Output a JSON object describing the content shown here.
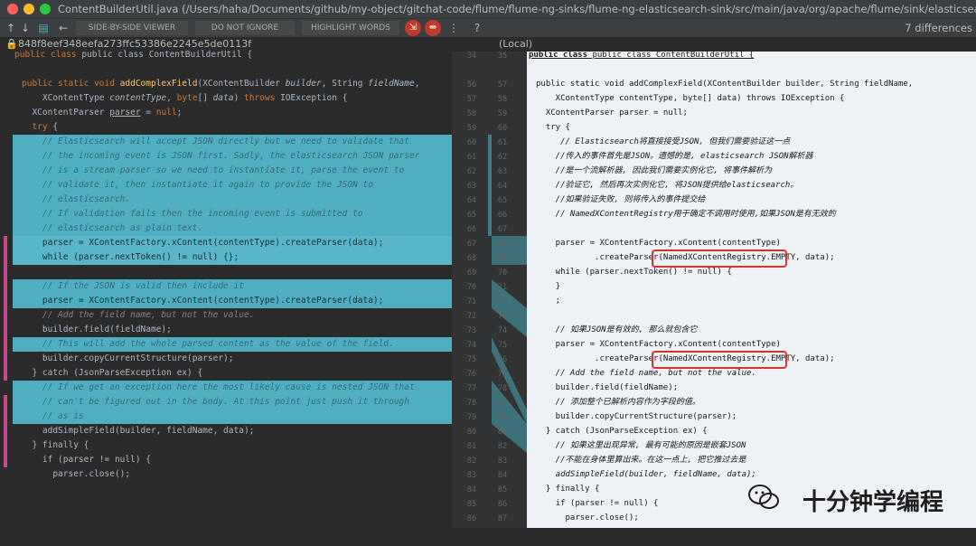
{
  "window": {
    "title": "ContentBuilderUtil.java (/Users/haha/Documents/github/my-object/gitchat-code/flume/flume-ng-sinks/flume-ng-elasticsearch-sink/src/main/java/org/apache/flume/sink/elasticsearch)",
    "differences": "7 differences"
  },
  "toolbar": {
    "viewer_label": "SIDE-BY-SIDE VIEWER",
    "ignore_label": "DO NOT IGNORE",
    "highlight_label": "HIGHLIGHT WORDS",
    "icons": [
      "arrow-up-icon",
      "arrow-down-icon",
      "edit-source-icon",
      "arrow-left-icon",
      "settings-icon",
      "help-icon"
    ]
  },
  "left": {
    "revision": "848f8eef348eefa273ffc53386e2245e5de0113f",
    "sticky": "public class ContentBuilderUtil {"
  },
  "right": {
    "revision": "(Local)",
    "sticky": "public class ContentBuilderUtil {"
  },
  "gutter_left": [
    "34",
    "56",
    "57",
    "58",
    "59",
    "60",
    "61",
    "62",
    "63",
    "64",
    "65",
    "66",
    "67",
    "68",
    "69",
    "70",
    "71",
    "72",
    "73",
    "74",
    "75",
    "76",
    "77",
    "78",
    "79",
    "80",
    "81",
    "82",
    "83",
    "84",
    "85",
    "86",
    "87"
  ],
  "gutter_right": [
    "35",
    "57",
    "58",
    "59",
    "60",
    "61",
    "62",
    "63",
    "64",
    "65",
    "66",
    "67",
    "68",
    "69",
    "70",
    "71",
    "72",
    "73",
    "74",
    "75",
    "76",
    "77",
    "78",
    "79",
    "80",
    "81",
    "82",
    "83",
    "84",
    "85",
    "86",
    "87"
  ],
  "left_code": [
    "public static void addComplexField(XContentBuilder builder, String fieldName,",
    "    XContentType contentType, byte[] data) throws IOException {",
    "  XContentParser parser = null;",
    "  try {",
    "    // Elasticsearch will accept JSON directly but we need to validate that",
    "    // the incoming event is JSON first. Sadly, the elasticsearch JSON parser",
    "    // is a stream parser so we need to instantiate it, parse the event to",
    "    // validate it, then instantiate it again to provide the JSON to",
    "    // elasticsearch.",
    "    // If validation fails then the incoming event is submitted to",
    "    // elasticsearch as plain text.",
    "    parser = XContentFactory.xContent(contentType).createParser(data);",
    "    while (parser.nextToken() != null) {};",
    "",
    "    // If the JSON is valid then include it",
    "    parser = XContentFactory.xContent(contentType).createParser(data);",
    "    // Add the field name, but not the value.",
    "    builder.field(fieldName);",
    "    // This will add the whole parsed content as the value of the field.",
    "    builder.copyCurrentStructure(parser);",
    "  } catch (JsonParseException ex) {",
    "    // If we get an exception here the most likely cause is nested JSON that",
    "    // can't be figured out in the body. At this point just push it through",
    "    // as is",
    "    addSimpleField(builder, fieldName, data);",
    "  } finally {",
    "    if (parser != null) {",
    "      parser.close();"
  ],
  "right_code": [
    "public static void addComplexField(XContentBuilder builder, String fieldName,",
    "    XContentType contentType, byte[] data) throws IOException {",
    "  XContentParser parser = null;",
    "  try {",
    "     // Elasticsearch将直接接受JSON, 但我们需要验证这一点",
    "    //传入的事件首先是JSON。遗憾的是, elasticsearch JSON解析器",
    "    //是一个流解析器, 因此我们需要实例化它, 将事件解析为",
    "    //验证它, 然后再次实例化它, 将JSON提供给elasticsearch。",
    "    //如果验证失败, 则将传入的事件提交给",
    "    // NamedXContentRegistry用于确定不调用时使用,如果JSON是有无效的",
    "",
    "    parser = XContentFactory.xContent(contentType)",
    "            .createParser(NamedXContentRegistry.EMPTY, data);",
    "    while (parser.nextToken() != null) {",
    "    }",
    "    ;",
    "",
    "    // 如果JSON是有效的, 那么就包含它",
    "    parser = XContentFactory.xContent(contentType)",
    "            .createParser(NamedXContentRegistry.EMPTY, data);",
    "    // Add the field name, but not the value.",
    "    builder.field(fieldName);",
    "    // 添加整个已解析内容作为字段的值。",
    "    builder.copyCurrentStructure(parser);",
    "  } catch (JsonParseException ex) {",
    "    // 如果这里出现异常, 最有可能的原因是嵌套JSON",
    "    //不能在身体里算出来。在这一点上, 把它推过去是",
    "    addSimpleField(builder, fieldName, data);",
    "  } finally {",
    "    if (parser != null) {",
    "      parser.close();"
  ],
  "watermark": "十分钟学编程"
}
